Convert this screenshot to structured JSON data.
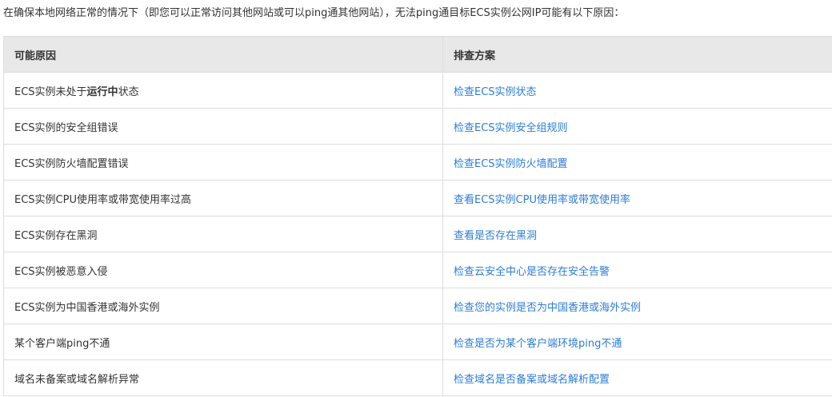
{
  "intro": "在确保本地网络正常的情况下（即您可以正常访问其他网站或可以ping通其他网站），无法ping通目标ECS实例公网IP可能有以下原因：",
  "table": {
    "headers": [
      "可能原因",
      "排查方案"
    ],
    "rows": [
      {
        "cause_prefix": "ECS实例未处于",
        "cause_bold": "运行中",
        "cause_suffix": "状态",
        "action": "检查ECS实例状态"
      },
      {
        "cause": "ECS实例的安全组错误",
        "action": "检查ECS实例安全组规则"
      },
      {
        "cause": "ECS实例防火墙配置错误",
        "action": "检查ECS实例防火墙配置"
      },
      {
        "cause": "ECS实例CPU使用率或带宽使用率过高",
        "action": "查看ECS实例CPU使用率或带宽使用率"
      },
      {
        "cause": "ECS实例存在黑洞",
        "action": "查看是否存在黑洞"
      },
      {
        "cause": "ECS实例被恶意入侵",
        "action": "检查云安全中心是否存在安全告警"
      },
      {
        "cause": "ECS实例为中国香港或海外实例",
        "action": "检查您的实例是否为中国香港或海外实例"
      },
      {
        "cause": "某个客户端ping不通",
        "action": "检查是否为某个客户端环境ping不通"
      },
      {
        "cause": "域名未备案或域名解析异常",
        "action": "检查域名是否备案或域名解析配置"
      }
    ]
  },
  "colors": {
    "link": "#2c7cd6",
    "header_bg": "#e8e8e8",
    "border": "#dddddd",
    "text": "#333333"
  }
}
